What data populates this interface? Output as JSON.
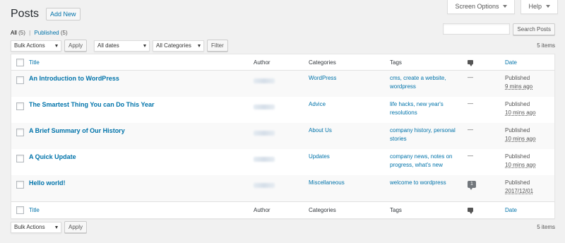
{
  "header": {
    "title": "Posts",
    "add_new": "Add New",
    "screen_options": "Screen Options",
    "help": "Help"
  },
  "views": {
    "all_label": "All",
    "all_count": "(5)",
    "separator": "|",
    "published_label": "Published",
    "published_count": "(5)"
  },
  "search": {
    "value": "",
    "button": "Search Posts"
  },
  "filters": {
    "bulk_actions": "Bulk Actions",
    "apply": "Apply",
    "dates": "All dates",
    "categories": "All Categories",
    "filter": "Filter",
    "items_count": "5 items"
  },
  "table": {
    "columns": {
      "title": "Title",
      "author": "Author",
      "categories": "Categories",
      "tags": "Tags",
      "date": "Date"
    },
    "rows": [
      {
        "title": "An Introduction to WordPress",
        "category": "WordPress",
        "tags_line1": "cms, create a website,",
        "tags_line2": "wordpress",
        "comments": "—",
        "status": "Published",
        "date": "9 mins ago"
      },
      {
        "title": "The Smartest Thing You can Do This Year",
        "category": "Advice",
        "tags_line1": "life hacks, new year's",
        "tags_line2": "resolutions",
        "comments": "—",
        "status": "Published",
        "date": "10 mins ago"
      },
      {
        "title": "A Brief Summary of Our History",
        "category": "About Us",
        "tags_line1": "company history, personal",
        "tags_line2": "stories",
        "comments": "—",
        "status": "Published",
        "date": "10 mins ago"
      },
      {
        "title": "A Quick Update",
        "category": "Updates",
        "tags_line1": "company news, notes on",
        "tags_line2": "progress, what's new",
        "comments": "—",
        "status": "Published",
        "date": "10 mins ago"
      },
      {
        "title": "Hello world!",
        "category": "Miscellaneous",
        "tags_line1": "welcome to wordpress",
        "tags_line2": "",
        "comments": "1",
        "status": "Published",
        "date": "2017/12/01"
      }
    ]
  },
  "colors": {
    "background": "#f1f1f1",
    "link": "#0073aa",
    "text": "#444444"
  }
}
